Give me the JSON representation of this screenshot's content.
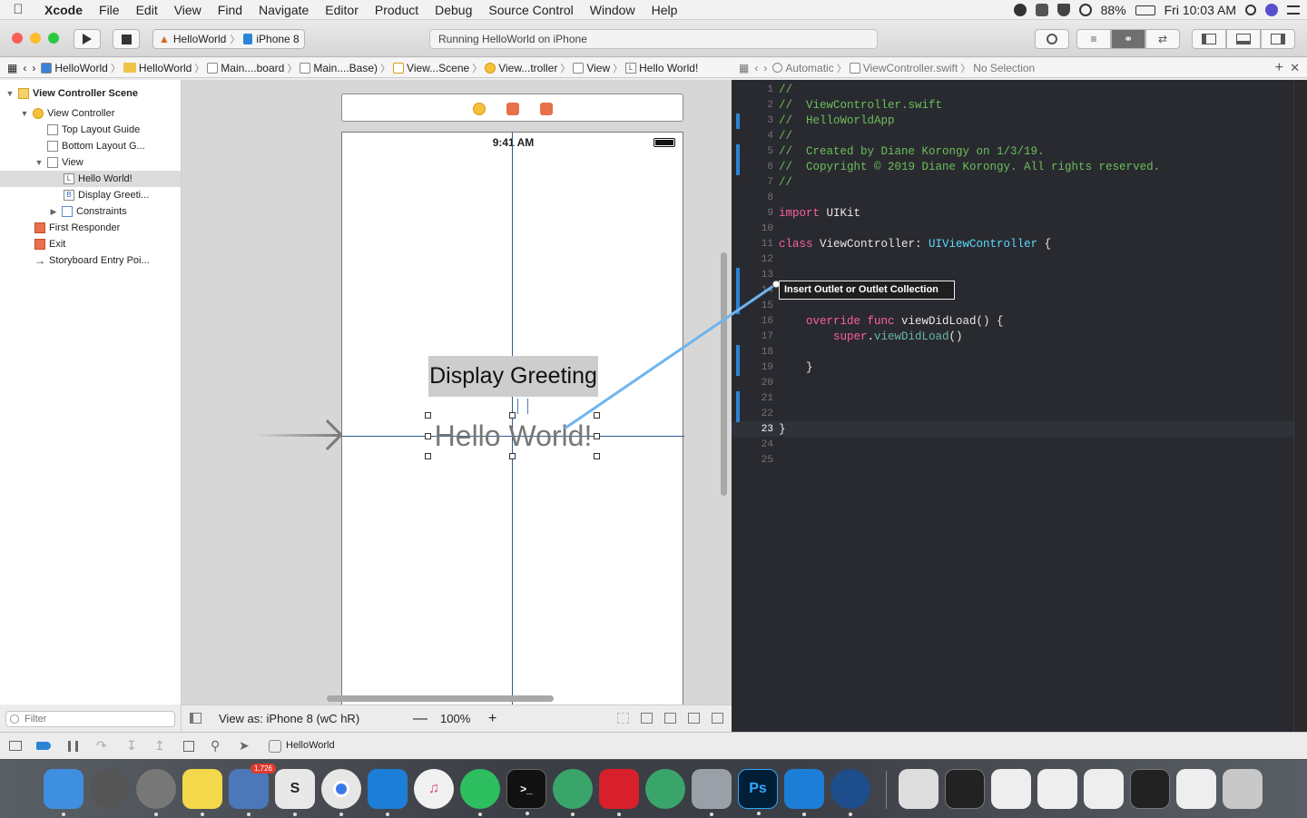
{
  "menubar": {
    "apple": "",
    "app": "Xcode",
    "items": [
      "File",
      "Edit",
      "View",
      "Find",
      "Navigate",
      "Editor",
      "Product",
      "Debug",
      "Source Control",
      "Window",
      "Help"
    ],
    "battery": "88%",
    "clock": "Fri 10:03 AM"
  },
  "toolbar": {
    "scheme": "HelloWorld",
    "device": "iPhone 8",
    "status": "Running HelloWorld on iPhone"
  },
  "jumpbar": {
    "crumbs": [
      "HelloWorld",
      "HelloWorld",
      "Main....board",
      "Main....Base)",
      "View...Scene",
      "View...troller",
      "View",
      "Hello World!"
    ],
    "right_mode": "Automatic",
    "right_file": "ViewController.swift",
    "right_sel": "No Selection"
  },
  "outline": {
    "items": [
      "View Controller Scene",
      "View Controller",
      "Top Layout Guide",
      "Bottom Layout G...",
      "View",
      "Hello World!",
      "Display Greeti...",
      "Constraints",
      "First Responder",
      "Exit",
      "Storyboard Entry Poi..."
    ],
    "icons": [
      "L",
      "B"
    ],
    "filter_placeholder": "Filter"
  },
  "canvas": {
    "status_time": "9:41 AM",
    "button_title": "Display Greeting",
    "label_text": "Hello World!",
    "view_as_prefix": "View as: iPhone 8 (",
    "size_class_w": "wC",
    "size_class_h": "hR",
    "view_as_suffix": ")",
    "zoom": "100%",
    "zoom_minus": "—",
    "zoom_plus": "+"
  },
  "editor": {
    "line_numbers": [
      "1",
      "2",
      "3",
      "4",
      "5",
      "6",
      "7",
      "8",
      "9",
      "10",
      "11",
      "12",
      "13",
      "14",
      "15",
      "16",
      "17",
      "18",
      "19",
      "20",
      "21",
      "22",
      "23",
      "24",
      "25"
    ],
    "current_line": "23",
    "lines": {
      "l1": "//",
      "l2": "//  ViewController.swift",
      "l3": "//  HelloWorldApp",
      "l4": "//",
      "l5": "//  Created by Diane Korongy on 1/3/19.",
      "l6": "//  Copyright © 2019 Diane Korongy. All rights reserved.",
      "l7": "//",
      "l9_kw": "import",
      "l9_rest": " UIKit",
      "l11_kw": "class",
      "l11_name": " ViewController: ",
      "l11_type": "UIViewController",
      "l11_end": " {",
      "l16_kw": "override func",
      "l16_rest": " viewDidLoad() {",
      "l17_kw": "super",
      "l17_dot": ".",
      "l17_fn": "viewDidLoad",
      "l17_end": "()",
      "l19": "}",
      "l23": "}"
    },
    "tooltip": "Insert Outlet or Outlet Collection"
  },
  "debugbar": {
    "target": "HelloWorld"
  },
  "dock": {
    "mail_badge": "1,726",
    "app_labels": [
      "Ps"
    ]
  }
}
